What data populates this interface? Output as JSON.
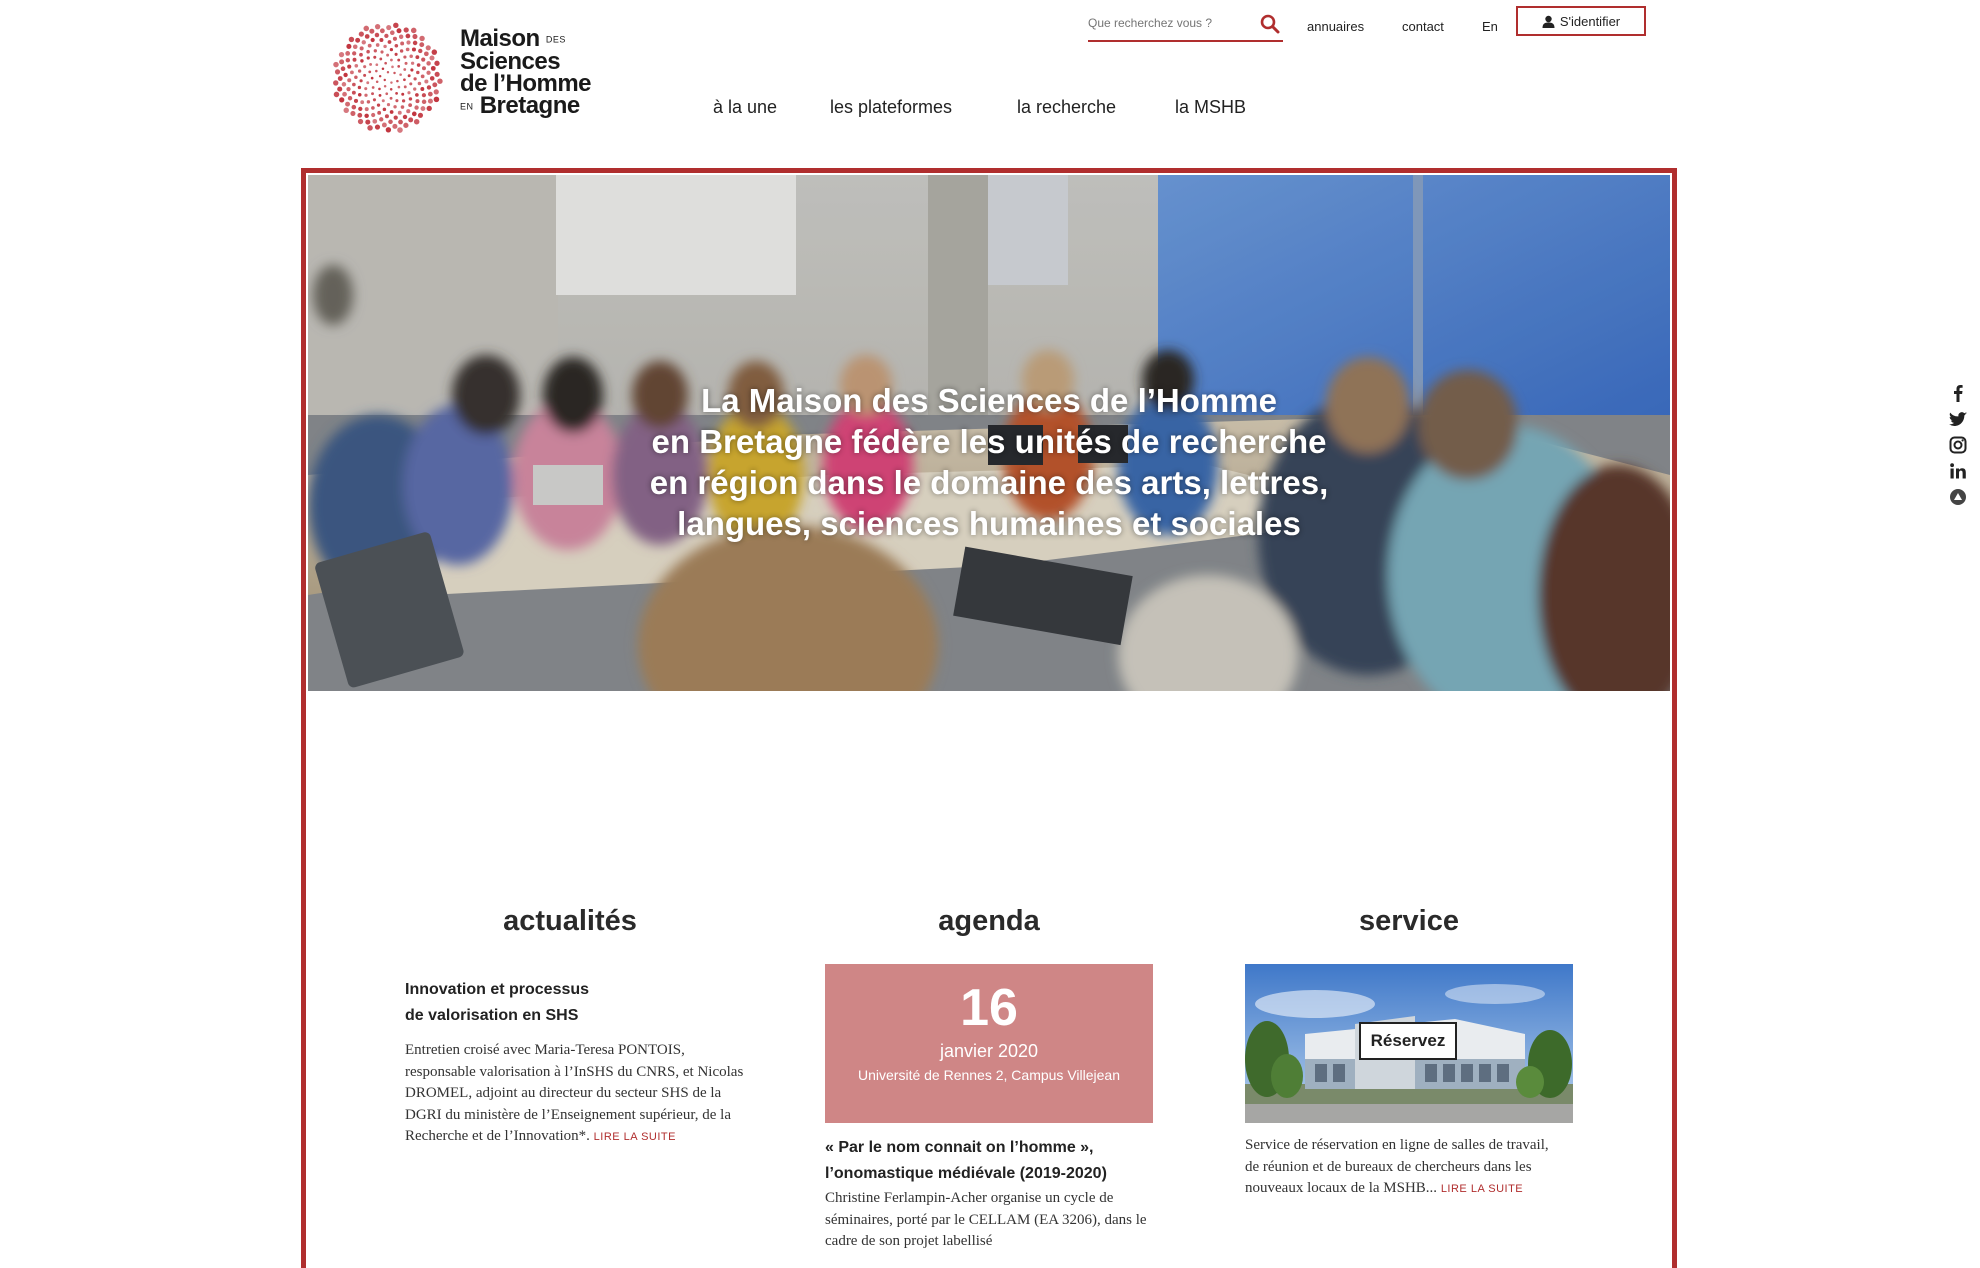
{
  "brand": {
    "line1": "Maison",
    "line1_small": "DES",
    "line2": "Sciences",
    "line3": "de l’Homme",
    "line4_small": "EN",
    "line4": "Bretagne",
    "accent_color": "#b02e2e"
  },
  "search": {
    "placeholder": "Que recherchez vous ?",
    "icon": "search-icon"
  },
  "utility_nav": {
    "directories": "annuaires",
    "contact": "contact",
    "language": "En",
    "login": "S'identifier"
  },
  "main_nav": [
    "à la une",
    "les plateformes",
    "la recherche",
    "la MSHB"
  ],
  "hero": {
    "lines": [
      "La Maison des Sciences de l’Homme",
      "en Bretagne fédère les unités de recherche",
      "en région dans le domaine des arts, lettres,",
      "langues, sciences humaines et sociales"
    ]
  },
  "social": [
    "facebook-icon",
    "twitter-icon",
    "instagram-icon",
    "linkedin-icon",
    "hal-icon"
  ],
  "columns": {
    "news": {
      "title": "actualités",
      "item_title_1": "Innovation et processus",
      "item_title_2": "de valorisation en SHS",
      "body": "Entretien croisé avec Maria-Teresa PONTOIS, responsable valorisation à l’InSHS du CNRS, et Nicolas DROMEL, adjoint au directeur du secteur SHS de la DGRI du ministère de l’Enseignement supérieur, de la Recherche et de l’Innovation*.",
      "more": "LIRE LA SUITE"
    },
    "agenda": {
      "title": "agenda",
      "day": "16",
      "month": "janvier 2020",
      "place": "Université de Rennes 2, Campus Villejean",
      "event_title_1": "« Par le nom connait on l’homme »,",
      "event_title_2": "l’onomastique médiévale (2019-2020)",
      "body": "Christine Ferlampin-Acher organise un cycle de séminaires, porté par le CELLAM (EA 3206), dans le cadre de son projet labellisé",
      "box_color": "#cf8686"
    },
    "service": {
      "title": "service",
      "button": "Réservez",
      "body": "Service de réservation en ligne de salles de travail, de réunion et de bureaux de chercheurs dans les nouveaux locaux de la MSHB...",
      "more": "LIRE LA SUITE"
    }
  }
}
